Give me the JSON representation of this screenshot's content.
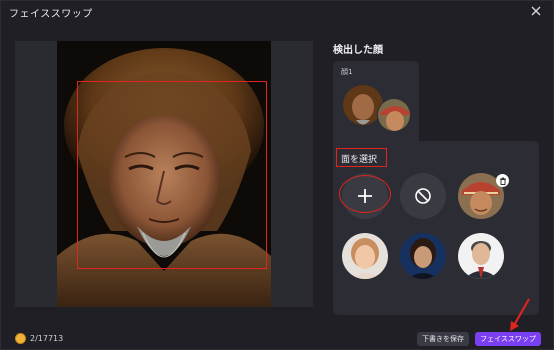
{
  "window": {
    "title": "フェイススワップ",
    "close_icon": "close-icon"
  },
  "detected": {
    "title": "検出した顔",
    "group_label": "顔1"
  },
  "select": {
    "label": "面を選択"
  },
  "footer": {
    "credits": "2/17713",
    "save_label": "下書きを保存",
    "swap_label": "フェイススワップ"
  },
  "colors": {
    "accent": "#7b3ff2",
    "highlight": "#e0241f",
    "background": "#1f1f25",
    "panel": "#2c2c34"
  }
}
